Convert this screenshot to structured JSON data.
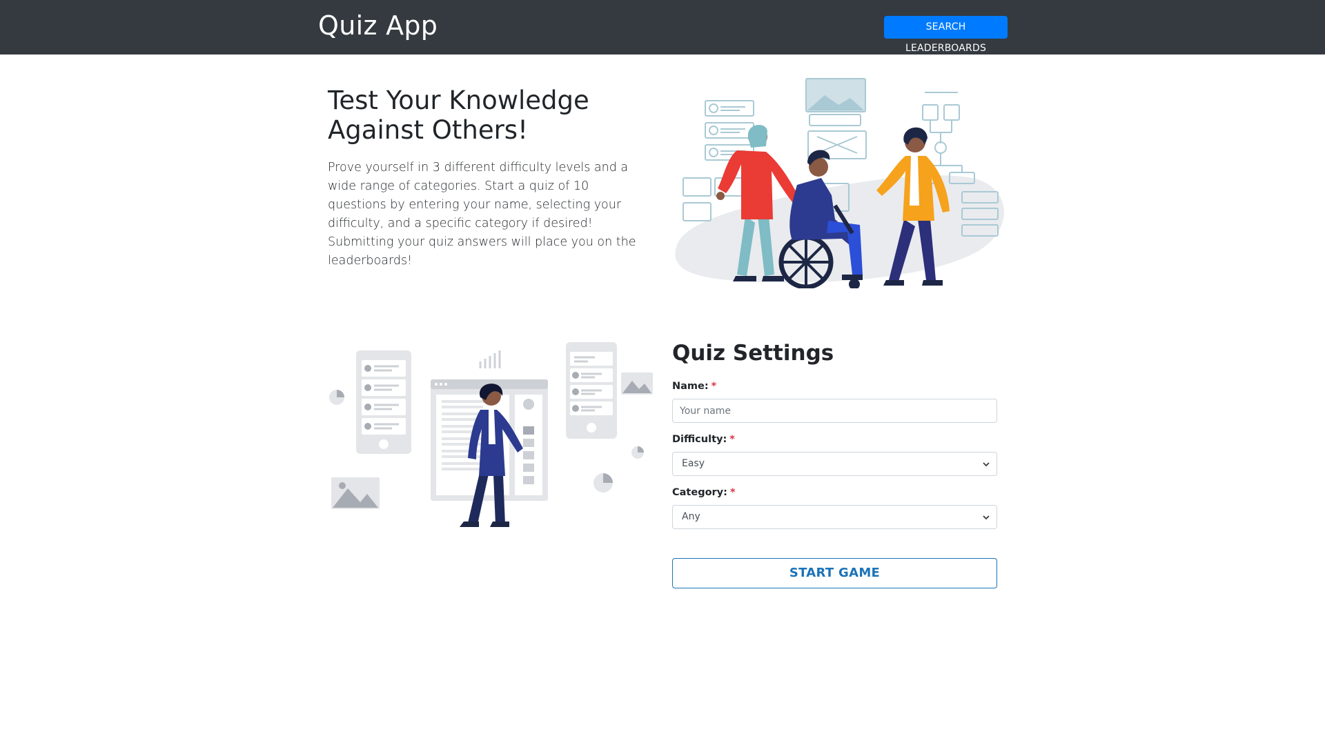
{
  "navbar": {
    "brand": "Quiz App",
    "search_button": "SEARCH LEADERBOARDS"
  },
  "hero": {
    "title_line1": "Test Your Knowledge",
    "title_line2": "Against Others!",
    "description": "Prove yourself in 3 different difficulty levels and a wide range of categories. Start a quiz of 10 questions by entering your name, selecting your difficulty, and a specific category if desired! Submitting your quiz answers will place you on the leaderboards!"
  },
  "settings": {
    "title": "Quiz Settings",
    "required_marker": "*",
    "name_label": "Name:",
    "name_placeholder": "Your name",
    "difficulty_label": "Difficulty:",
    "difficulty_value": "Easy",
    "category_label": "Category:",
    "category_value": "Any",
    "start_button": "START GAME"
  },
  "icons": {
    "dropdown": "chevron-down-icon"
  },
  "colors": {
    "navbar_bg": "#343a40",
    "primary": "#007bff",
    "required": "#dc3545",
    "start_button": "#1b73b8"
  }
}
